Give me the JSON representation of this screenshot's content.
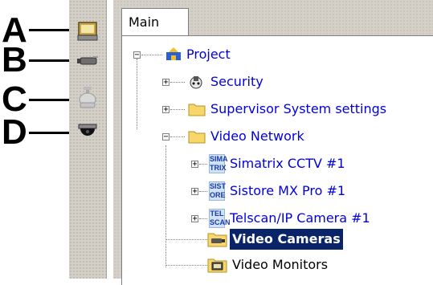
{
  "callouts": [
    "A",
    "B",
    "C",
    "D"
  ],
  "tab": {
    "label": "Main"
  },
  "toolbar": {
    "buttons": [
      {
        "icon": "monitor-icon"
      },
      {
        "icon": "camera-icon"
      },
      {
        "icon": "ptz-camera-icon"
      },
      {
        "icon": "dome-camera-icon"
      }
    ]
  },
  "tree": {
    "root": {
      "label": "Project",
      "state": "−"
    },
    "security": {
      "label": "Security",
      "state": "+"
    },
    "supervisor": {
      "label": "Supervisor System settings",
      "state": "+"
    },
    "video_network": {
      "label": "Video Network",
      "state": "−"
    },
    "simatrix": {
      "label": "Simatrix CCTV #1",
      "state": "+",
      "badge": [
        "SIMA",
        "TRIX"
      ]
    },
    "sistore": {
      "label": "Sistore MX Pro #1",
      "state": "+",
      "badge": [
        "SIST",
        "ORE"
      ]
    },
    "telscan": {
      "label": "Telscan/IP Camera #1",
      "state": "+",
      "badge": [
        "TEL",
        "SCAN"
      ]
    },
    "video_cameras": {
      "label": "Video Cameras"
    },
    "video_monitors": {
      "label": "Video Monitors"
    }
  },
  "colors": {
    "selection": "#0a246a",
    "link": "#0000e0",
    "chrome": "#d4d0c8"
  }
}
